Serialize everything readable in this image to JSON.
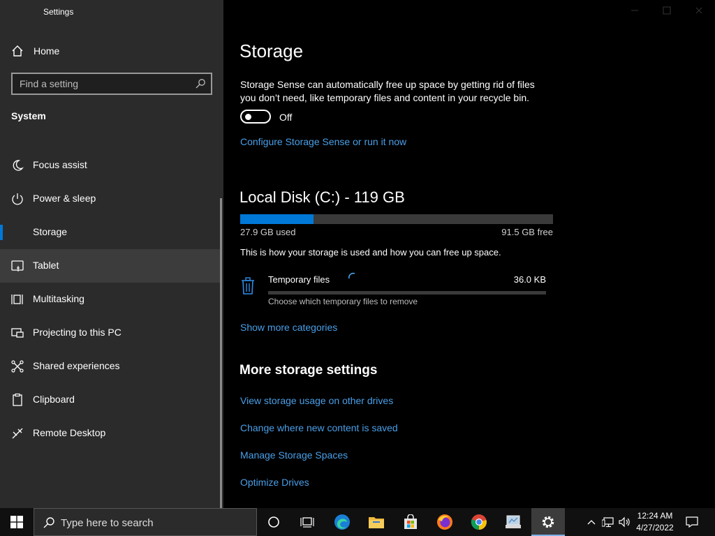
{
  "window": {
    "title": "Settings"
  },
  "sidebar": {
    "home_label": "Home",
    "search_placeholder": "Find a setting",
    "section_title": "System",
    "items": [
      {
        "label": "Focus assist",
        "icon": "moon-icon"
      },
      {
        "label": "Power & sleep",
        "icon": "power-icon"
      },
      {
        "label": "Storage",
        "icon": "storage-icon",
        "selected": true
      },
      {
        "label": "Tablet",
        "icon": "tablet-icon",
        "hovered": true
      },
      {
        "label": "Multitasking",
        "icon": "multitasking-icon"
      },
      {
        "label": "Projecting to this PC",
        "icon": "projecting-icon"
      },
      {
        "label": "Shared experiences",
        "icon": "shared-icon"
      },
      {
        "label": "Clipboard",
        "icon": "clipboard-icon"
      },
      {
        "label": "Remote Desktop",
        "icon": "remote-desktop-icon"
      }
    ]
  },
  "main": {
    "title": "Storage",
    "storage_sense_desc": "Storage Sense can automatically free up space by getting rid of files you don’t need, like temporary files and content in your recycle bin.",
    "toggle_state": "Off",
    "configure_link": "Configure Storage Sense or run it now",
    "disk": {
      "title": "Local Disk (C:) - 119 GB",
      "used_label": "27.9 GB used",
      "free_label": "91.5 GB free",
      "used_fraction": 0.234
    },
    "usage_text": "This is how your storage is used and how you can free up space.",
    "category": {
      "name": "Temporary files",
      "size": "36.0 KB",
      "description": "Choose which temporary files to remove"
    },
    "show_more_link": "Show more categories",
    "more_settings_title": "More storage settings",
    "more_links": [
      "View storage usage on other drives",
      "Change where new content is saved",
      "Manage Storage Spaces",
      "Optimize Drives"
    ]
  },
  "taskbar": {
    "search_placeholder": "Type here to search",
    "time": "12:24 AM",
    "date": "4/27/2022"
  },
  "colors": {
    "accent": "#0078d7",
    "link": "#4a9fe8",
    "sidebar_bg": "#2b2b2b",
    "main_bg": "#000000"
  }
}
